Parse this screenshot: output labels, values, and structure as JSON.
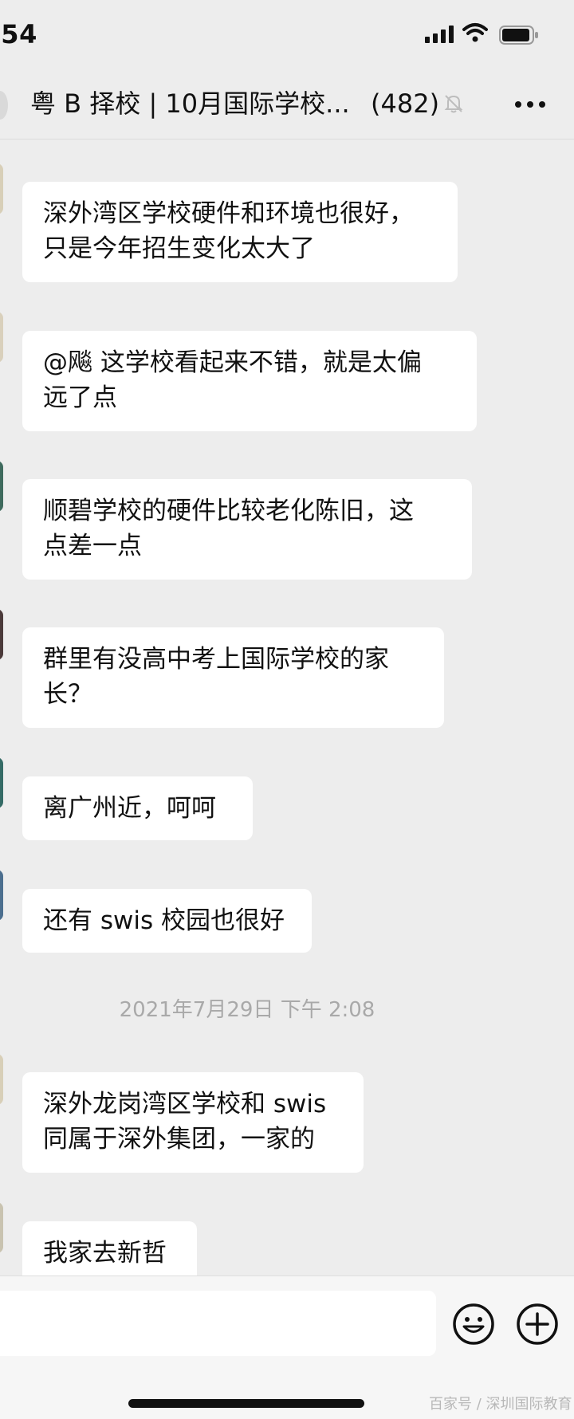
{
  "status_bar": {
    "time": ":54",
    "icons": [
      "cellular-signal-icon",
      "wifi-icon",
      "battery-icon"
    ]
  },
  "header": {
    "title": "粤 B 择校 | 10月国际学校...",
    "member_count": "(482)",
    "icons": [
      "mute-bell-icon",
      "more-options-icon"
    ]
  },
  "messages": [
    {
      "lines": [
        "深外湾区学校硬件和环境也很好，",
        "只是今年招生变化太大了"
      ]
    },
    {
      "lines": [
        "@飚 这学校看起来不错，就是太偏",
        "远了点"
      ]
    },
    {
      "lines": [
        "顺碧学校的硬件比较老化陈旧，这",
        "点差一点"
      ]
    },
    {
      "lines": [
        "群里有没高中考上国际学校的家",
        "长？"
      ]
    },
    {
      "lines": [
        "离广州近，呵呵"
      ]
    },
    {
      "lines": [
        "还有 swis 校园也很好"
      ]
    },
    {
      "lines": [
        "深外龙岗湾区学校和 swis",
        "同属于深外集团，一家的"
      ]
    },
    {
      "lines": [
        "我家去新哲"
      ]
    }
  ],
  "timestamp": "2021年7月29日 下午 2:08",
  "input_bar": {
    "icons": [
      "emoji-icon",
      "plus-icon"
    ]
  },
  "watermark": "百家号 / 深圳国际教育",
  "colors": {
    "background": "#ededed",
    "bubble": "#ffffff",
    "timestamp": "#a9a9a9"
  }
}
